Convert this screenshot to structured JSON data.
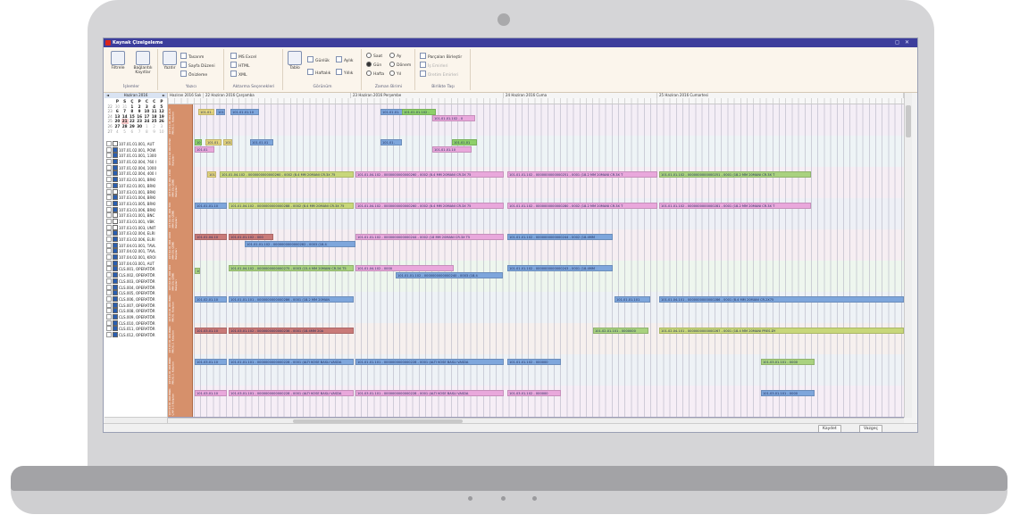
{
  "window": {
    "title": "Kaynak Çizelgeleme",
    "controls": [
      "◻",
      "✕"
    ]
  },
  "ribbon": {
    "groups": [
      {
        "caption": "İşlemler",
        "buttons": [
          {
            "label": "Filtrele"
          },
          {
            "label": "Bağlantılı Kayıtlar"
          }
        ]
      },
      {
        "caption": "Yazıcı",
        "buttons": [
          {
            "label": "Yazdır"
          }
        ],
        "items": [
          "Tasarım",
          "Sayfa Düzeni",
          "Önizleme"
        ]
      },
      {
        "caption": "Aktarma Seçenekleri",
        "items": [
          "MS Excel",
          "HTML",
          "XML"
        ]
      },
      {
        "caption": "Görünüm",
        "buttons": [
          {
            "label": "Tablo"
          }
        ],
        "items": [
          "Günlük",
          "Aylık",
          "Haftalık",
          "Yıllık"
        ]
      },
      {
        "caption": "Zaman Birimi",
        "items": [
          "Saat",
          "Ay",
          "Gün",
          "Dönem",
          "Hafta",
          "Yıl"
        ]
      },
      {
        "caption": "Birlikte Taşı",
        "items": [
          "Parçaları Birleştir",
          "İş Emirleri",
          "Üretim Emirleri"
        ]
      }
    ]
  },
  "calendar": {
    "month": "Haziran 2016",
    "prev": "◄",
    "next": "►",
    "weekdays": [
      "P",
      "S",
      "Ç",
      "P",
      "C",
      "C",
      "P"
    ],
    "weeks": [
      {
        "wk": "22",
        "days": [
          "30",
          "31",
          "1",
          "2",
          "3",
          "4",
          "5"
        ]
      },
      {
        "wk": "23",
        "days": [
          "6",
          "7",
          "8",
          "9",
          "10",
          "11",
          "12"
        ]
      },
      {
        "wk": "24",
        "days": [
          "13",
          "14",
          "15",
          "16",
          "17",
          "18",
          "19"
        ]
      },
      {
        "wk": "25",
        "days": [
          "20",
          "21",
          "22",
          "23",
          "24",
          "25",
          "26"
        ]
      },
      {
        "wk": "26",
        "days": [
          "27",
          "28",
          "29",
          "30",
          "1",
          "2",
          "3"
        ]
      },
      {
        "wk": "27",
        "days": [
          "4",
          "5",
          "6",
          "7",
          "8",
          "9",
          "10"
        ]
      }
    ]
  },
  "tree": {
    "rows": [
      "107.01.01.001, AUT",
      "107.01.02.001, POW",
      "107.01.01.001, 1300",
      "107.01.02.004, 760 I",
      "107.01.02.004, 1000",
      "107.01.02.004, 400 I",
      "107.02.01.001, BRKI",
      "107.02.01.001, BRKI",
      "107.03.01.001, BRKI",
      "107.03.01.004, BRKI",
      "107.03.01.005, BRKI",
      "107.03.01.006, BRKI",
      "107.03.01.001, BNC",
      "107.03.01.001, VBK",
      "107.03.01.003, UNIT",
      "107.03.02.004, ELRI",
      "107.03.02.006, ELRI",
      "107.04.01.001, TAVL",
      "107.04.02.001, TAVL",
      "107.04.02.001, KROI",
      "107.04.03.001, AUT",
      "CLS.001, OPERATÖR",
      "CLS.002, OPERATÖR",
      "CLS.003, OPERATÖR",
      "CLS.004, OPERATÖR",
      "CLS.005, OPERATÖR",
      "CLS.006, OPERATÖR",
      "CLS.007, OPERATÖR",
      "CLS.008, OPERATÖR",
      "CLS.009, OPERATÖR",
      "CLS.010, OPERATÖR",
      "CLS.011, OPERATÖR",
      "CLS.012, OPERATÖR"
    ]
  },
  "schedule": {
    "days": [
      "Haziran 2016 Salı",
      "22 Haziran 2016 Çarşamba",
      "23 Haziran 2016 Perşembe",
      "24 Haziran 2016 Cuma",
      "25 Haziran 2016 Cumartesi"
    ],
    "resources": [
      {
        "label": "107.01.01.001 AUT. PROG.1. Kalıpları"
      },
      {
        "label": "107.01.02.001 POW. Kalıpları"
      },
      {
        "label": "107.01.02.001 1300 MM ZIL ÇENE Kalıpları"
      },
      {
        "label": "107.02.01.004 760 MM ZIL ÇENE Kalıpları"
      },
      {
        "label": "107.02.01.004 1000 MM ZIL ÇENE Kalıpları"
      },
      {
        "label": "107.02.01.004 400 MM ZIL ÇENE Kalıpları"
      },
      {
        "label": "107.03.01.001 BRKI. PROG. Kalıpları"
      },
      {
        "label": "107.03.01.001 BRKI. PROG.2. Kalıpları"
      },
      {
        "label": "107.03.01.004 BRKI. PROG.3. Kalıpları"
      },
      {
        "label": "107.03.01.006 BRKI. ÇAP 2.5 Kalıpları"
      }
    ],
    "appointments": [
      {
        "row": 0,
        "text": "101.01.",
        "color": "yellow"
      },
      {
        "row": 0,
        "text": "101.",
        "color": "blue"
      },
      {
        "row": 0,
        "text": "101.01.01.10",
        "color": "blue"
      },
      {
        "row": 0,
        "text": "101.01.01.",
        "color": "blue"
      },
      {
        "row": 0,
        "text": "101.01.01.102 -",
        "color": "lime"
      },
      {
        "row": 0,
        "text": "101.01.01.102 - 0",
        "color": "pink"
      },
      {
        "row": 1,
        "text": "101.",
        "color": "lime"
      },
      {
        "row": 1,
        "text": "101.01.",
        "color": "yellow"
      },
      {
        "row": 1,
        "text": "101",
        "color": "yellow"
      },
      {
        "row": 1,
        "text": "101.01.01",
        "color": "blue"
      },
      {
        "row": 1,
        "text": "101.01",
        "color": "pink"
      },
      {
        "row": 1,
        "text": "101.01.",
        "color": "blue"
      },
      {
        "row": 1,
        "text": "101.01.01",
        "color": "lime"
      },
      {
        "row": 1,
        "text": "101.01.01.10",
        "color": "pink"
      },
      {
        "row": 2,
        "text": "101.",
        "color": "yellow"
      },
      {
        "row": 2,
        "text": "101.01.04.102 - 0000000000000260 - 0002 (8.4 MM 20MANI CR.3X 75",
        "color": "olive"
      },
      {
        "row": 2,
        "text": "101.01.04.102 - 0000000000000260 - 0002 (8.4 MM 20MANI CR.3X 75",
        "color": "pink"
      },
      {
        "row": 2,
        "text": "101.01.01.102 - 0000000000000251 - 0001 (18.2 MM 20MANI CR.3X T",
        "color": "pink"
      },
      {
        "row": 2,
        "text": "101.01.01.102 - 0000000000000251 - 0001 (18.2 MM 20MANI CR.3X T",
        "color": "green"
      },
      {
        "row": 3,
        "text": "101.01.01.10",
        "color": "blue"
      },
      {
        "row": 3,
        "text": "101.01.04.102 - 0000000000000288 - 0002 (8.4 MM 20MANI CR.3X 75",
        "color": "olive"
      },
      {
        "row": 3,
        "text": "101.01.04.102 - 0000000000000260 - 0002 (8.4 MM 20MANI CR.3X 75",
        "color": "pink"
      },
      {
        "row": 3,
        "text": "101.01.01.102 - 0000000000000280 - 0002 (18.2 MM 20MANI CR.3X T",
        "color": "pink"
      },
      {
        "row": 3,
        "text": "101.01.01.102 - 0000000000000281 - 0001 (18.2 MM 20MANI CR.3X T",
        "color": "pink"
      },
      {
        "row": 4,
        "text": "101.01.04.10",
        "color": "red"
      },
      {
        "row": 4,
        "text": "101.01.01.102 - 000",
        "color": "red"
      },
      {
        "row": 4,
        "text": "101.01.01.102 - 0000000000000282 - 0003 (18.4",
        "color": "blue"
      },
      {
        "row": 4,
        "text": "101.01.01.102 - 0000000000000244 - 0002 (18 MM 20MANI CR.3X T5",
        "color": "pink"
      },
      {
        "row": 4,
        "text": "101.01.01.102 - 0000000000000244 - 0002 (18.4MM",
        "color": "blue"
      },
      {
        "row": 5,
        "text": "101.01.04.10",
        "color": "green"
      },
      {
        "row": 5,
        "text": "101.01.04.102 - 0000000000000275 - 0003 (15.4 MM 20MANI CR.3X T5",
        "color": "green"
      },
      {
        "row": 5,
        "text": "101.01.04.102 - 0000",
        "color": "pink"
      },
      {
        "row": 5,
        "text": "101.01.01.102 - 0000000000000240 - 0003 (18.4",
        "color": "blue"
      },
      {
        "row": 5,
        "text": "101.01.01.102 - 0000000000000243 - 0001 (18.4MM",
        "color": "blue"
      },
      {
        "row": 6,
        "text": "101.02.01.10",
        "color": "blue"
      },
      {
        "row": 6,
        "text": "101.01.01.101 - 0000000000000286 - 0001 (18.2 MM 20MAN",
        "color": "blue"
      },
      {
        "row": 6,
        "text": "101.01.01.101",
        "color": "blue"
      },
      {
        "row": 6,
        "text": "101.01.04.101 - 0000000000000286 - 0001 (8.4 MM 20MANI CR.2X75",
        "color": "blue"
      },
      {
        "row": 7,
        "text": "101.03.01.10",
        "color": "red"
      },
      {
        "row": 7,
        "text": "101.03.01.102 - 0000000000000236 - 0001 (18.4MM 20A",
        "color": "red"
      },
      {
        "row": 7,
        "text": "101.02.01.101 - 0000000",
        "color": "green"
      },
      {
        "row": 7,
        "text": "101.02.04.101 - 0000000000000267 - 0001 (18.4 MM 20MANI PRES.DY",
        "color": "olive"
      },
      {
        "row": 8,
        "text": "101.03.01.10",
        "color": "blue"
      },
      {
        "row": 8,
        "text": "101.01.01.101 - 0000000000000228 - 0001 (ALTI KOSE BASLI VASDA",
        "color": "blue"
      },
      {
        "row": 8,
        "text": "101.01.01.101 - 0000000000000228 - 0001 (ALTI KOSE BASLI VASDA",
        "color": "blue"
      },
      {
        "row": 8,
        "text": "101.01.01.102 - 000000",
        "color": "blue"
      },
      {
        "row": 8,
        "text": "101.03.01.101 - 0000",
        "color": "green"
      },
      {
        "row": 9,
        "text": "101.03.01.10",
        "color": "pink"
      },
      {
        "row": 9,
        "text": "101.03.01.101 - 0000000000000228 - 0001 (ALTI KOSE BASLI VASDA",
        "color": "pink"
      },
      {
        "row": 9,
        "text": "101.03.01.101 - 0000000000000228 - 0001 (ALTI KOSE BASLI VASDA",
        "color": "pink"
      },
      {
        "row": 9,
        "text": "101.03.01.102 - 000000",
        "color": "pink"
      },
      {
        "row": 9,
        "text": "101.03.01.101 - 0000",
        "color": "blue"
      }
    ]
  },
  "footer": {
    "ok": "Kaydet",
    "cancel": "Vazgeç"
  }
}
